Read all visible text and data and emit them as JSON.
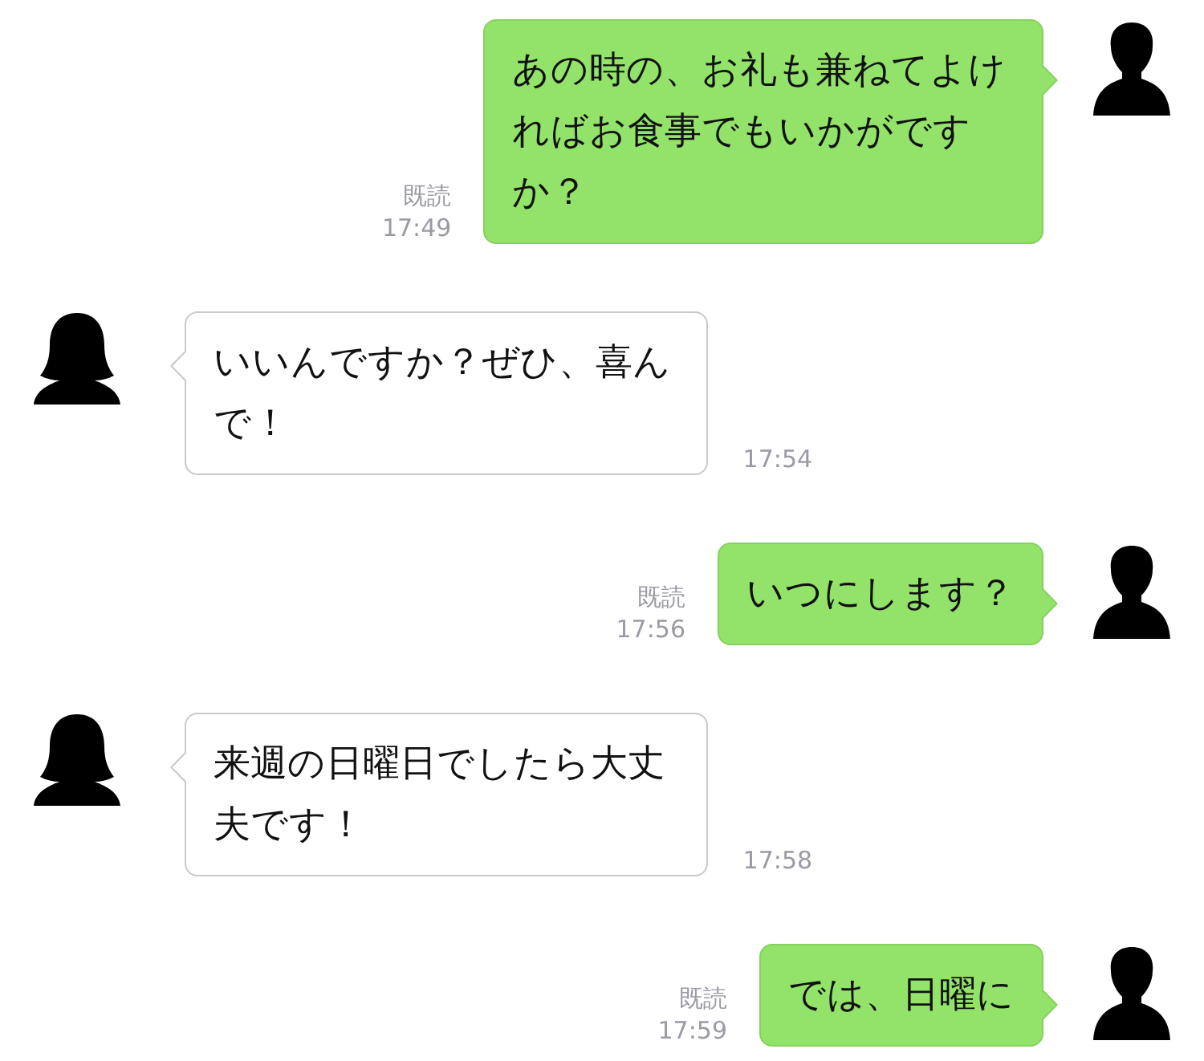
{
  "messages": [
    {
      "kind": "sent",
      "text": "あの時の、お礼も兼ねてよければお食事でもいかがですか？",
      "receipt": "既読",
      "time": "17:49"
    },
    {
      "kind": "received",
      "text": "いいんですか？ぜひ、喜んで！",
      "time": "17:54"
    },
    {
      "kind": "sent",
      "text": "いつにします？",
      "receipt": "既読",
      "time": "17:56"
    },
    {
      "kind": "received",
      "text": "来週の日曜日でしたら大丈夫です！",
      "time": "17:58"
    },
    {
      "kind": "sent",
      "text": "では、日曜に",
      "receipt": "既読",
      "time": "17:59"
    }
  ]
}
